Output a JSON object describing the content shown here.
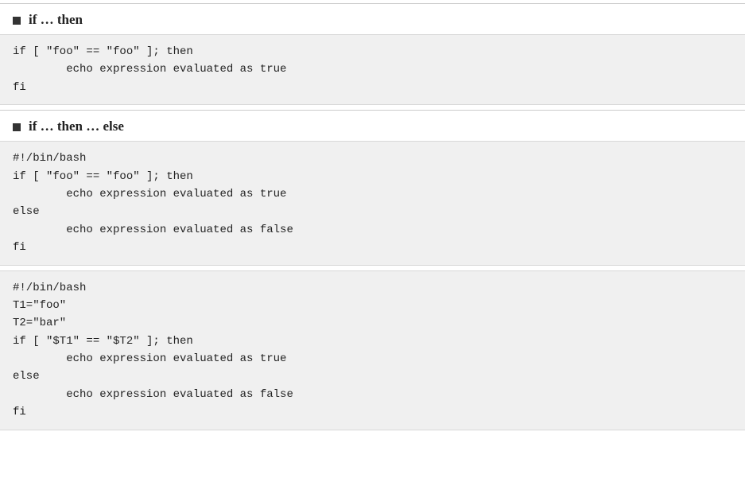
{
  "sections": [
    {
      "id": "if-then",
      "title": "if … then",
      "code_blocks": [
        {
          "lines": [
            "if [ \"foo\" == \"foo\" ]; then",
            "        echo expression evaluated as true",
            "fi"
          ]
        }
      ]
    },
    {
      "id": "if-then-else",
      "title": "if … then … else",
      "code_blocks": [
        {
          "lines": [
            "#!/bin/bash",
            "if [ \"foo\" == \"foo\" ]; then",
            "        echo expression evaluated as true",
            "else",
            "        echo expression evaluated as false",
            "fi"
          ]
        },
        {
          "lines": [
            "#!/bin/bash",
            "T1=\"foo\"",
            "T2=\"bar\"",
            "if [ \"$T1\" == \"$T2\" ]; then",
            "        echo expression evaluated as true",
            "else",
            "        echo expression evaluated as false",
            "fi"
          ]
        }
      ]
    }
  ]
}
